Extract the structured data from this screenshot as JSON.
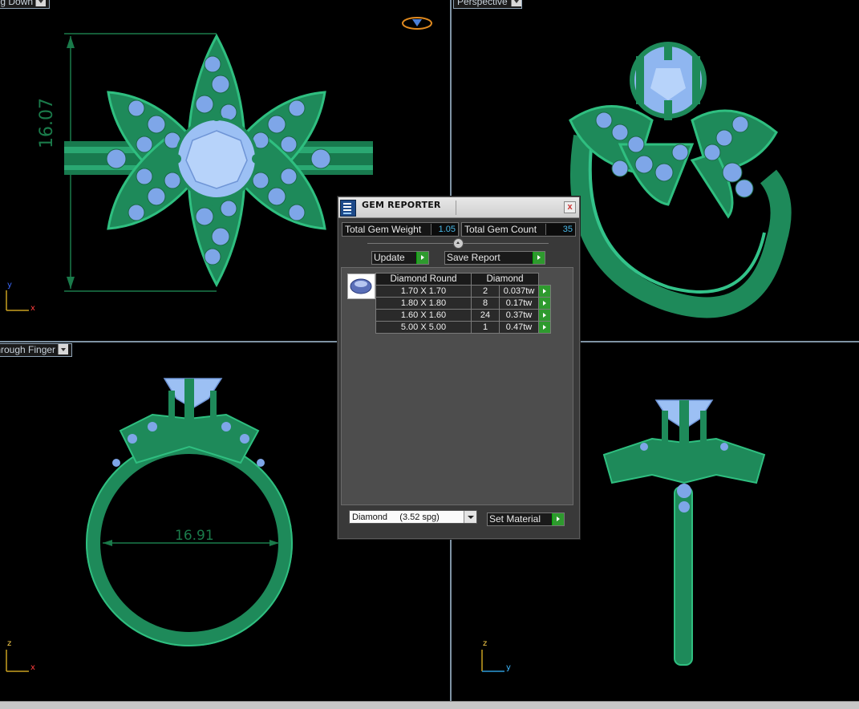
{
  "viewports": {
    "top_left": {
      "label": "Looking Down",
      "dimension": "16.07",
      "axis_v": "y",
      "axis_h": "x"
    },
    "top_right": {
      "label": "Perspective"
    },
    "bottom_left": {
      "label": "Through Finger",
      "dimension": "16.91",
      "axis_v": "z",
      "axis_h": "x"
    },
    "bottom_right": {
      "axis_v": "z",
      "axis_h": "y"
    }
  },
  "gem_reporter": {
    "title": "GEM REPORTER",
    "close_label": "x",
    "total_weight_label": "Total Gem Weight",
    "total_weight_value": "1.05",
    "total_count_label": "Total Gem Count",
    "total_count_value": "35",
    "update_label": "Update",
    "save_report_label": "Save Report",
    "table_headers": [
      "Diamond Round",
      "Diamond"
    ],
    "rows": [
      {
        "size": "1.70 X 1.70",
        "count": "2",
        "weight": "0.037tw"
      },
      {
        "size": "1.80 X 1.80",
        "count": "8",
        "weight": "0.17tw"
      },
      {
        "size": "1.60 X 1.60",
        "count": "24",
        "weight": "0.37tw"
      },
      {
        "size": "5.00 X 5.00",
        "count": "1",
        "weight": "0.47tw"
      }
    ],
    "material_value": "Diamond     (3.52 spg)",
    "set_material_label": "Set Material"
  },
  "colors": {
    "metal": "#1e8a5a",
    "gem": "#8fb6f0",
    "dimension": "#1a7a4a",
    "panel": "#393939"
  }
}
